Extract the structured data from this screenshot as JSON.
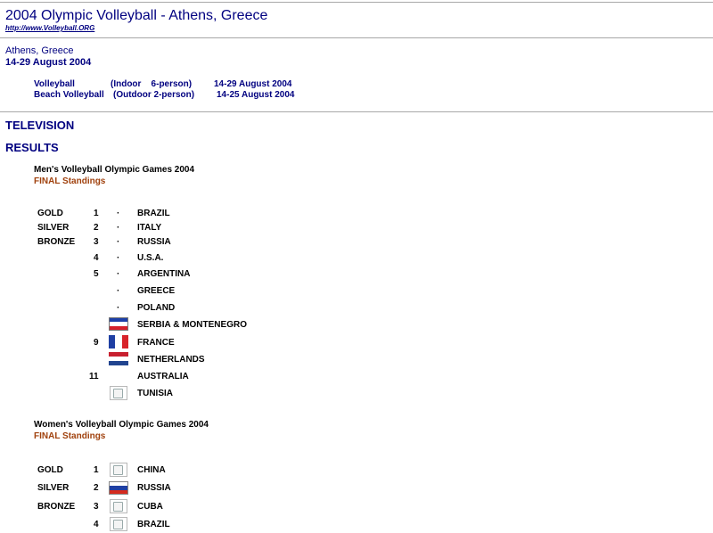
{
  "header": {
    "title": "2004 Olympic Volleyball - Athens, Greece",
    "url": "http://www.Volleyball.ORG"
  },
  "location": "Athens, Greece",
  "dates": "14-29 August 2004",
  "events": [
    {
      "name": "Volleyball",
      "type": "(Indoor    6-person)",
      "dates": "14-29 August 2004"
    },
    {
      "name": "Beach Volleyball",
      "type": "(Outdoor 2-person)",
      "dates": "14-25 August 2004"
    }
  ],
  "sections": {
    "television": "TELEVISION",
    "results": "RESULTS"
  },
  "men": {
    "title": "Men's Volleyball Olympic Games 2004",
    "subtitle": "FINAL Standings",
    "rows": [
      {
        "medal": "GOLD",
        "rank": "1",
        "mark": "·",
        "country": "BRAZIL"
      },
      {
        "medal": "SILVER",
        "rank": "2",
        "mark": "·",
        "country": "ITALY"
      },
      {
        "medal": "BRONZE",
        "rank": "3",
        "mark": "·",
        "country": "RUSSIA"
      },
      {
        "medal": "",
        "rank": "4",
        "mark": "·",
        "country": "U.S.A."
      },
      {
        "medal": "",
        "rank": "5",
        "mark": "·",
        "country": "ARGENTINA"
      },
      {
        "medal": "",
        "rank": "",
        "mark": "·",
        "country": "GREECE"
      },
      {
        "medal": "",
        "rank": "",
        "mark": "·",
        "country": "POLAND"
      },
      {
        "medal": "",
        "rank": "",
        "flag": "serbia-montenegro-flag",
        "country": "SERBIA & MONTENEGRO"
      },
      {
        "medal": "",
        "rank": "9",
        "flag": "france-flag",
        "country": "FRANCE"
      },
      {
        "medal": "",
        "rank": "",
        "flag": "netherlands-flag",
        "country": "NETHERLANDS"
      },
      {
        "medal": "",
        "rank": "11",
        "country": "AUSTRALIA"
      },
      {
        "medal": "",
        "rank": "",
        "flag": "broken-image-icon",
        "country": "TUNISIA"
      }
    ]
  },
  "women": {
    "title": "Women's Volleyball Olympic Games 2004",
    "subtitle": "FINAL Standings",
    "rows": [
      {
        "medal": "GOLD",
        "rank": "1",
        "flag": "broken-image-icon",
        "country": "CHINA"
      },
      {
        "medal": "SILVER",
        "rank": "2",
        "flag": "russia-flag",
        "country": "RUSSIA"
      },
      {
        "medal": "BRONZE",
        "rank": "3",
        "flag": "broken-image-icon",
        "country": "CUBA"
      },
      {
        "medal": "",
        "rank": "4",
        "flag": "broken-image-icon",
        "country": "BRAZIL"
      }
    ]
  },
  "colors": {
    "navy": "#000080",
    "rust": "#a0410d",
    "rule": "#a8a8a8"
  }
}
